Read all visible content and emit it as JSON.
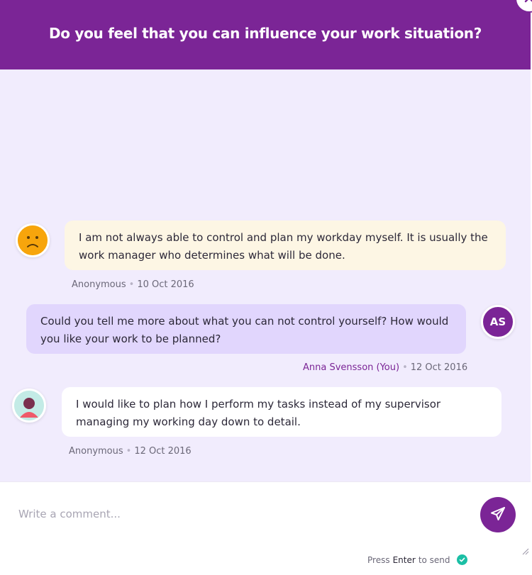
{
  "header": {
    "title": "Do you feel that you can influence your work situation?"
  },
  "messages": [
    {
      "avatar_icon": "sad-face-icon",
      "text": "I am not always able to control and plan my workday myself. It is usually the work manager who determines what will be done.",
      "author": "Anonymous",
      "date": "10 Oct 2016"
    },
    {
      "avatar_initials": "AS",
      "text": "Could you tell me more about what you can not control yourself? How would you like your work to be planned?",
      "author": "Anna Svensson (You)",
      "date": "12 Oct 2016"
    },
    {
      "avatar_icon": "person-avatar-icon",
      "text": "I would like to plan how I perform my tasks instead of my supervisor managing my working day down to detail.",
      "author": "Anonymous",
      "date": "12 Oct 2016"
    }
  ],
  "composer": {
    "placeholder": "Write a comment...",
    "hint_prefix": "Press",
    "hint_key": "Enter",
    "hint_suffix": "to send"
  },
  "icons": {
    "close": "close-icon",
    "send": "send-icon",
    "check": "check-icon"
  },
  "colors": {
    "brand": "#7b2596",
    "chat_background": "#f1ecfd",
    "bubble_anonymous": "#fdf6e4",
    "bubble_you": "#e1d6fd",
    "success": "#1bbfa5",
    "sad_face": "#f7a50c"
  }
}
